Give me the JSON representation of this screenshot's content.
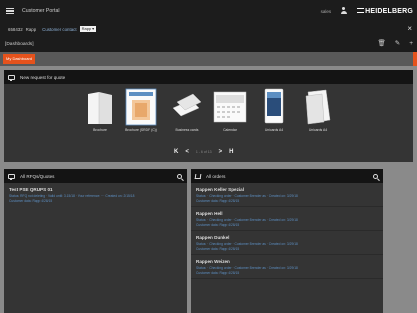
{
  "app": {
    "title": "Customer Portal",
    "user": "sales",
    "brand": "HEIDELBERG"
  },
  "subbar": {
    "customer_id": "658432",
    "customer_name": "Rapp",
    "contact_label": "Customer contact",
    "contact_value": "Rapp"
  },
  "context": {
    "label": "[Dashboards]"
  },
  "tabs": {
    "active": "My Dashboard"
  },
  "quote_panel": {
    "title": "New request for quote",
    "products": [
      {
        "label": "Brochure",
        "icon": "brochure-icon"
      },
      {
        "label": "Brochure (SRDF (C))",
        "icon": "flyer-icon"
      },
      {
        "label": "Business cards",
        "icon": "business-cards-icon"
      },
      {
        "label": "Calendar",
        "icon": "calendar-icon"
      },
      {
        "label": "Unicards A4",
        "icon": "mobile-card-icon"
      },
      {
        "label": "Unicards A4",
        "icon": "paper-icon"
      }
    ],
    "pager": {
      "first": "K",
      "prev": "<",
      "text": "1 - 6 of 13",
      "next": ">",
      "last": "H"
    }
  },
  "rfq_panel": {
    "title": "All RFQs/Quotes",
    "items": [
      {
        "title": "Test PSE QRUPS 01",
        "meta1": "Status: RFQ not deleting · Valid until: 3.15/18 · Your reference: ··· Created on: 2/15/18",
        "meta2": "Customer data: Rapp 4/28/15"
      }
    ]
  },
  "orders_panel": {
    "title": "All orders",
    "items": [
      {
        "title": "Rappen Keller Spezial",
        "meta1": "Status: · Checking order · Customer Brender as · Created on: 3/29/18",
        "meta2": "Customer data: Rapp 4/28/15"
      },
      {
        "title": "Rappen Hell",
        "meta1": "Status: · Checking order · Customer Brender as · Created on: 3/29/18",
        "meta2": "Customer data: Rapp 4/28/15"
      },
      {
        "title": "Rappen Dunkel",
        "meta1": "Status: · Checking order · Customer Brender as · Created on: 3/29/18",
        "meta2": "Customer data: Rapp 4/28/15"
      },
      {
        "title": "Rappen Weizen",
        "meta1": "Status: · Checking order · Customer Brender as · Created on: 3/29/18",
        "meta2": "Customer data: Rapp 4/28/15"
      }
    ]
  },
  "colors": {
    "accent": "#e5521c",
    "link": "#5d8fc2",
    "dark_bar": "#1c1c1c",
    "panel": "#343434"
  }
}
